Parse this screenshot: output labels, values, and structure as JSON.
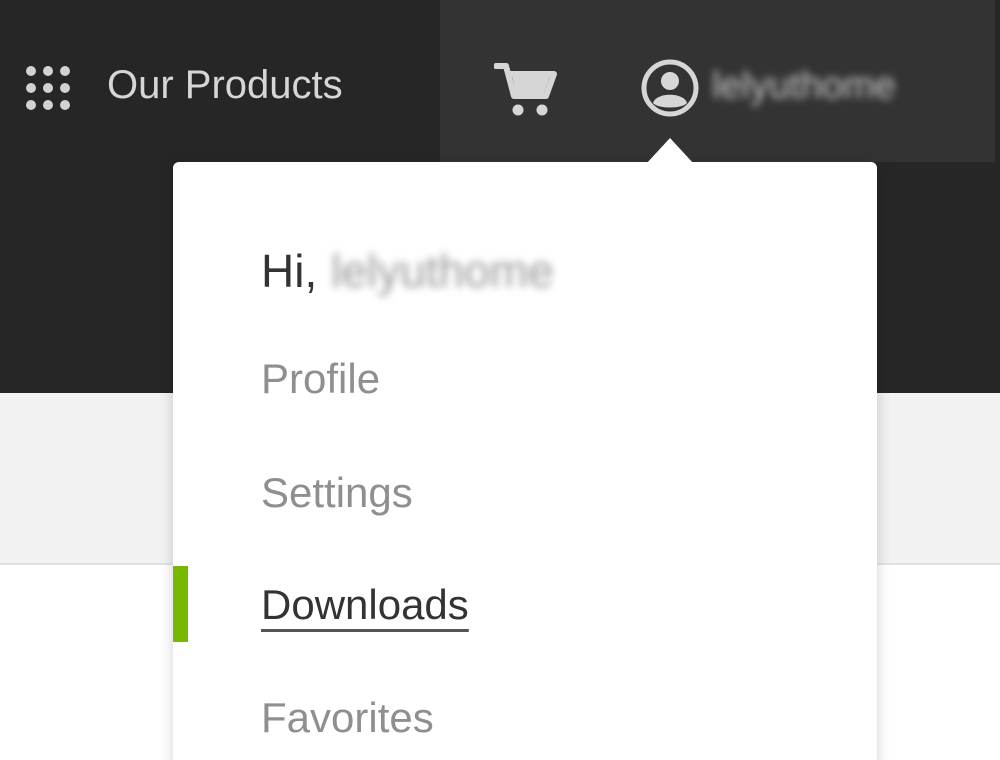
{
  "header": {
    "products_label": "Our Products",
    "products_icon": "grid-icon",
    "cart_icon": "cart-icon",
    "user_icon": "user-circle-icon",
    "username": "lelyuthome"
  },
  "dropdown": {
    "greeting": "Hi,",
    "greeting_name": "lelyuthome",
    "items": [
      {
        "label": "Profile"
      },
      {
        "label": "Settings"
      },
      {
        "label": "Downloads",
        "active": true
      },
      {
        "label": "Favorites"
      }
    ]
  },
  "colors": {
    "header_bg": "#262626",
    "user_area_bg": "#333333",
    "accent": "#76b900",
    "menu_text": "#8f8f8f",
    "menu_active_text": "#333333"
  }
}
